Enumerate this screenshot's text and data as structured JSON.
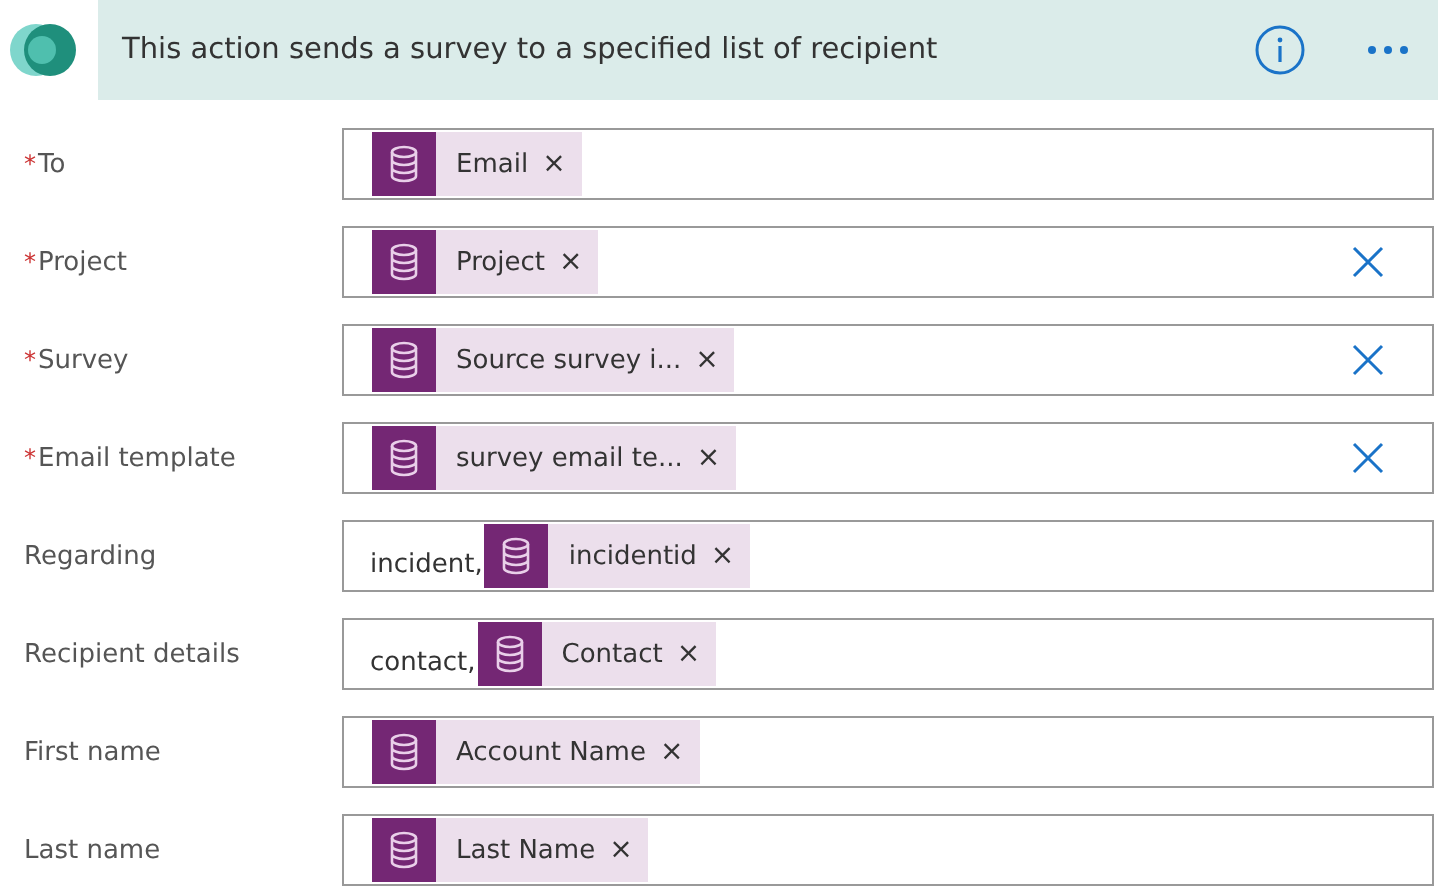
{
  "header": {
    "title": "This action sends a survey to a specified list of recipient"
  },
  "fields": [
    {
      "label": "To",
      "asterisk": "*",
      "tokens": [
        {
          "label": "Email",
          "remove": "×"
        }
      ],
      "clearable": false
    },
    {
      "label": "Project",
      "asterisk": "*",
      "tokens": [
        {
          "label": "Project",
          "remove": "×"
        }
      ],
      "clearable": true
    },
    {
      "label": "Survey",
      "asterisk": "*",
      "tokens": [
        {
          "label": "Source survey i...",
          "remove": "×"
        }
      ],
      "clearable": true
    },
    {
      "label": "Email template",
      "asterisk": "*",
      "tokens": [
        {
          "label": "survey email te...",
          "remove": "×"
        }
      ],
      "clearable": true
    },
    {
      "label": "Regarding",
      "prefix": "incident,",
      "tokens": [
        {
          "label": "incidentid",
          "remove": "×"
        }
      ],
      "clearable": false
    },
    {
      "label": "Recipient details",
      "prefix": "contact,",
      "tokens": [
        {
          "label": "Contact",
          "remove": "×"
        }
      ],
      "clearable": false
    },
    {
      "label": "First name",
      "tokens": [
        {
          "label": "Account Name",
          "remove": "×"
        }
      ],
      "clearable": false
    },
    {
      "label": "Last name",
      "tokens": [
        {
          "label": "Last Name",
          "remove": "×"
        }
      ],
      "clearable": false
    }
  ]
}
